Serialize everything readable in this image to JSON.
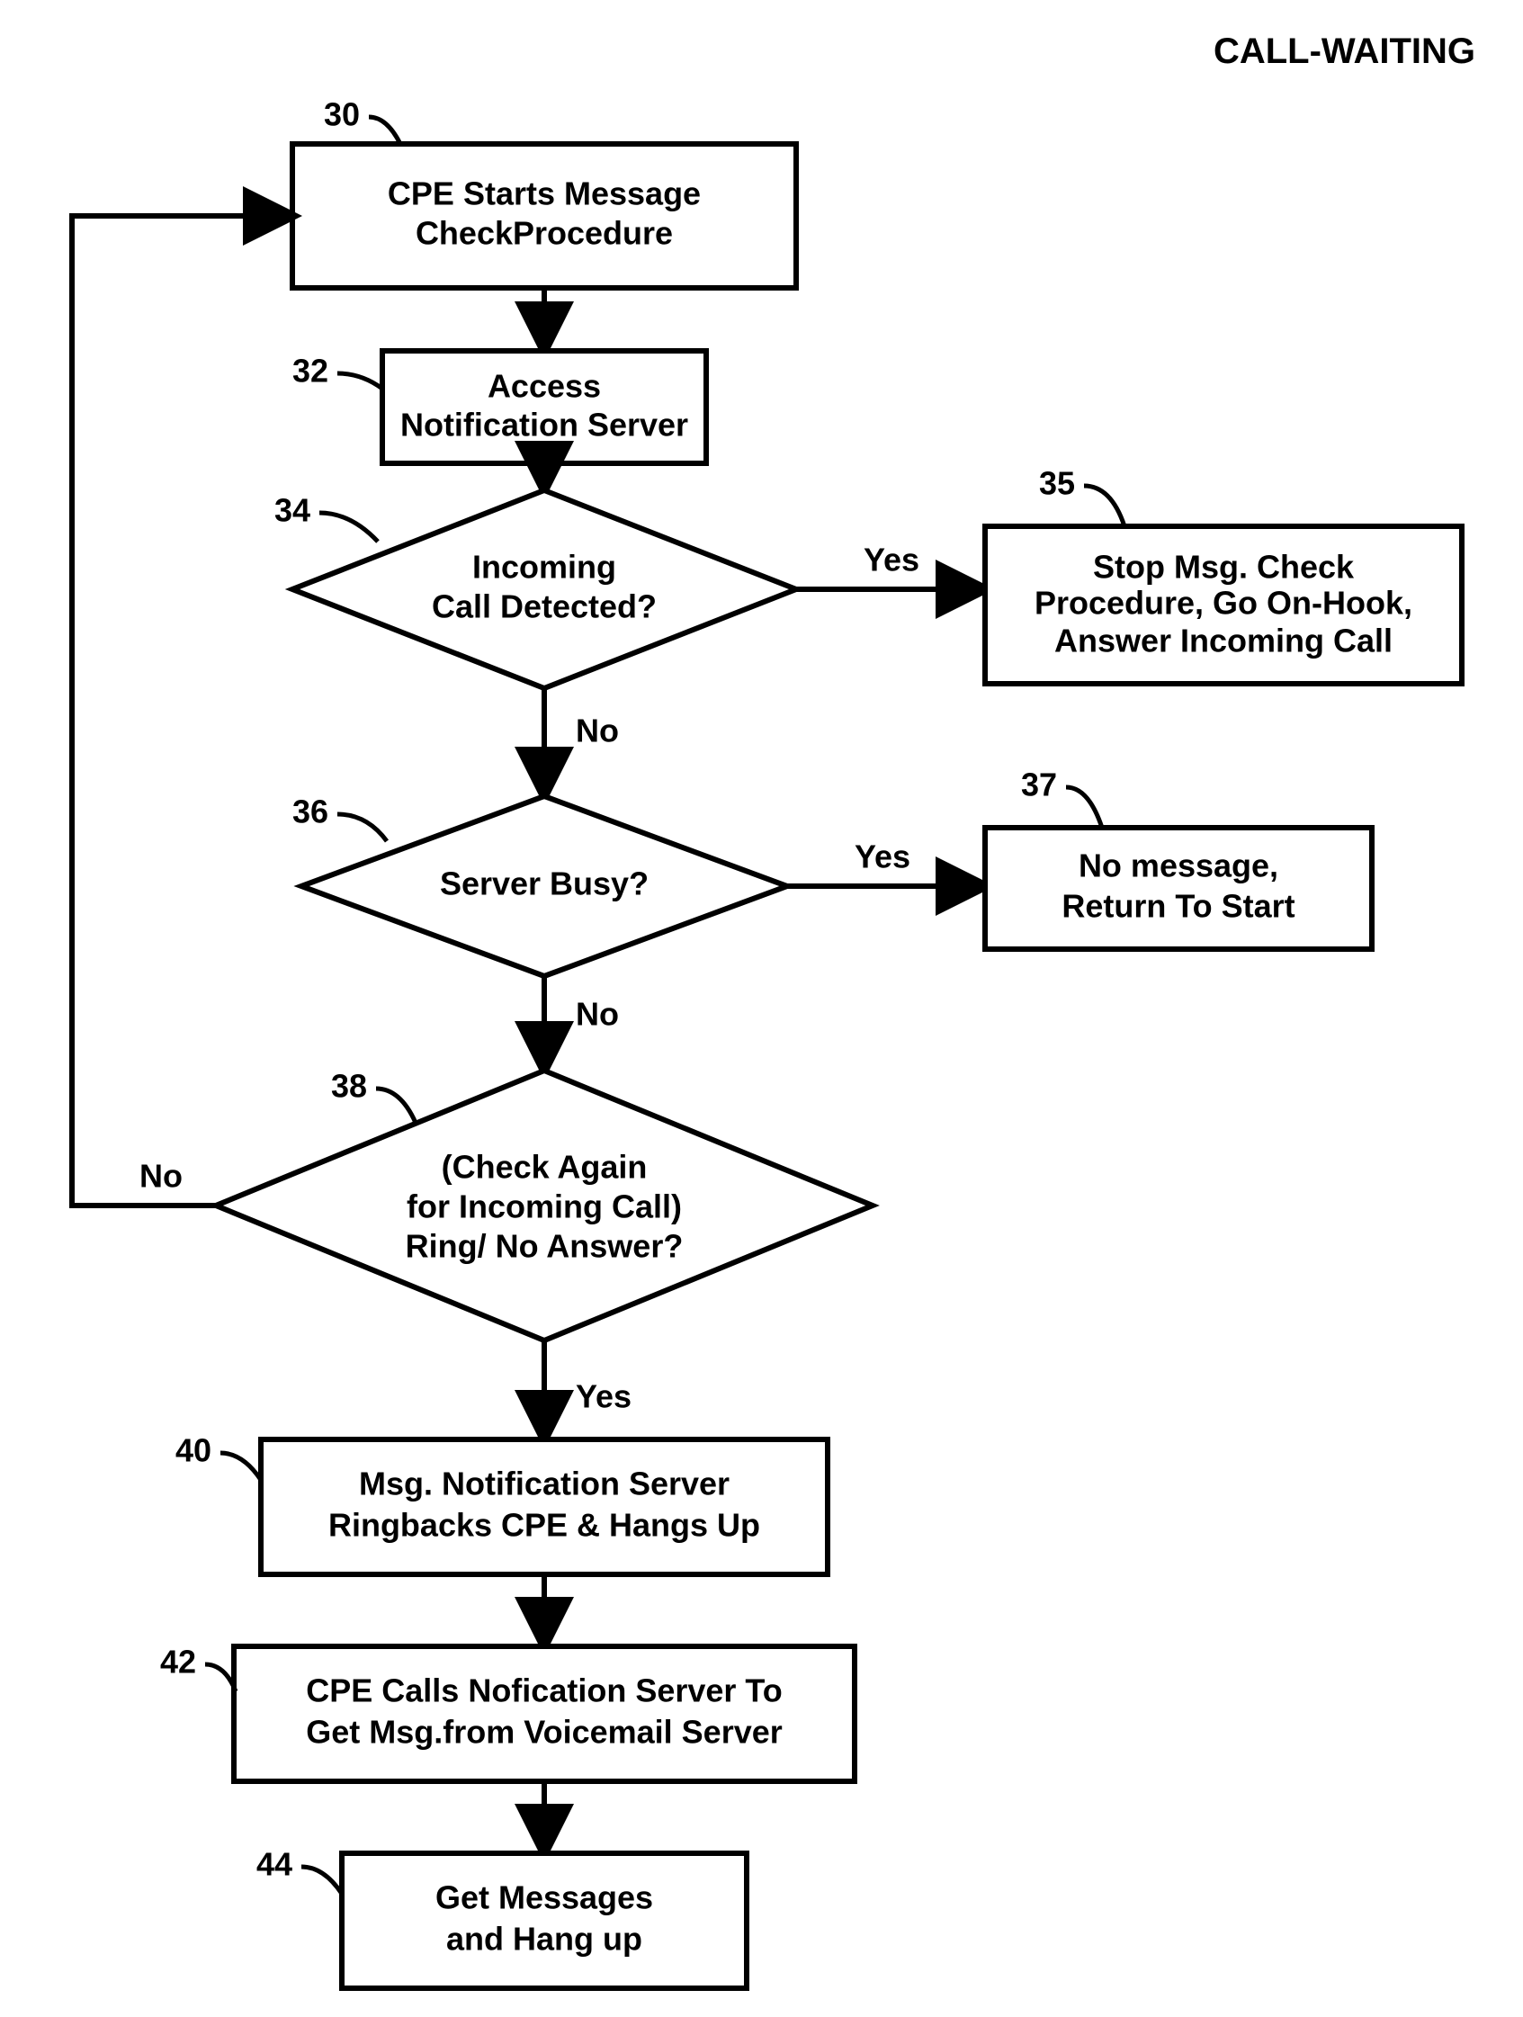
{
  "title": "CALL-WAITING",
  "nodes": {
    "n30": {
      "ref": "30",
      "line1": "CPE Starts Message",
      "line2": "CheckProcedure"
    },
    "n32": {
      "ref": "32",
      "line1": "Access",
      "line2": "Notification Server"
    },
    "n34": {
      "ref": "34",
      "line1": "Incoming",
      "line2": "Call Detected?"
    },
    "n35": {
      "ref": "35",
      "line1": "Stop Msg. Check",
      "line2": "Procedure, Go On-Hook,",
      "line3": "Answer Incoming Call"
    },
    "n36": {
      "ref": "36",
      "line1": "Server Busy?"
    },
    "n37": {
      "ref": "37",
      "line1": "No message,",
      "line2": "Return To Start"
    },
    "n38": {
      "ref": "38",
      "line1": "(Check Again",
      "line2": "for Incoming Call)",
      "line3": "Ring/ No Answer?"
    },
    "n40": {
      "ref": "40",
      "line1": "Msg. Notification Server",
      "line2": "Ringbacks CPE & Hangs Up"
    },
    "n42": {
      "ref": "42",
      "line1": "CPE Calls Nofication Server To",
      "line2": "Get Msg.from Voicemail Server"
    },
    "n44": {
      "ref": "44",
      "line1": "Get Messages",
      "line2": "and Hang up"
    }
  },
  "edges": {
    "e34yes": "Yes",
    "e34no": "No",
    "e36yes": "Yes",
    "e36no": "No",
    "e38yes": "Yes",
    "e38no": "No"
  }
}
